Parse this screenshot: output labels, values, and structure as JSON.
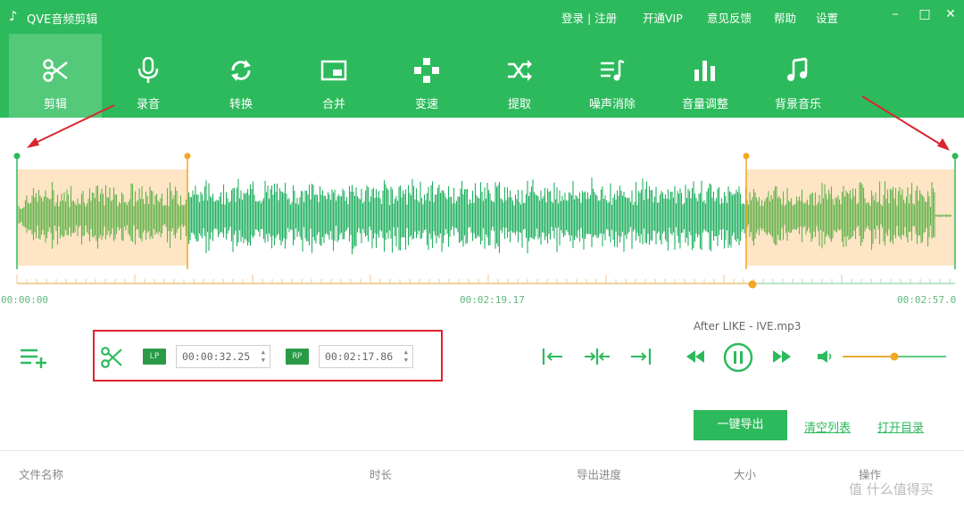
{
  "app": {
    "title": "QVE音频剪辑",
    "logo_icon": "music-note-icon"
  },
  "top_links": {
    "login_register": "登录 | 注册",
    "vip": "开通VIP",
    "feedback": "意见反馈",
    "help": "帮助",
    "settings": "设置"
  },
  "window": {
    "minimize": "–",
    "maximize": "□",
    "close": "✕"
  },
  "toolbar": {
    "items": [
      {
        "label": "剪辑",
        "icon": "scissors-icon",
        "active": true
      },
      {
        "label": "录音",
        "icon": "microphone-icon",
        "active": false
      },
      {
        "label": "转换",
        "icon": "convert-icon",
        "active": false
      },
      {
        "label": "合并",
        "icon": "merge-icon",
        "active": false
      },
      {
        "label": "变速",
        "icon": "speed-icon",
        "active": false
      },
      {
        "label": "提取",
        "icon": "extract-icon",
        "active": false
      },
      {
        "label": "噪声消除",
        "icon": "noise-removal-icon",
        "active": false
      },
      {
        "label": "音量调整",
        "icon": "volume-adjust-icon",
        "active": false
      },
      {
        "label": "背景音乐",
        "icon": "background-music-icon",
        "active": false
      }
    ]
  },
  "timeline": {
    "start": "00:00:00",
    "selection_mid": "00:02:19.17",
    "end": "00:02:57.0"
  },
  "cut": {
    "lp_tag": "LP",
    "lp_time": "00:00:32.25",
    "rp_tag": "RP",
    "rp_time": "00:02:17.86"
  },
  "player": {
    "filename": "After LIKE - IVE.mp3",
    "volume_level": 0.5
  },
  "actions": {
    "export": "一键导出",
    "clear_list": "清空列表",
    "open_dir": "打开目录"
  },
  "table": {
    "headers": [
      "文件名称",
      "时长",
      "导出进度",
      "大小",
      "操作"
    ]
  },
  "watermark": "值 什么值得买",
  "colors": {
    "brand_green": "#2dba5c",
    "selection_orange": "#fde5c6",
    "handle_orange": "#f5a623",
    "highlight_red": "#e0232d"
  }
}
